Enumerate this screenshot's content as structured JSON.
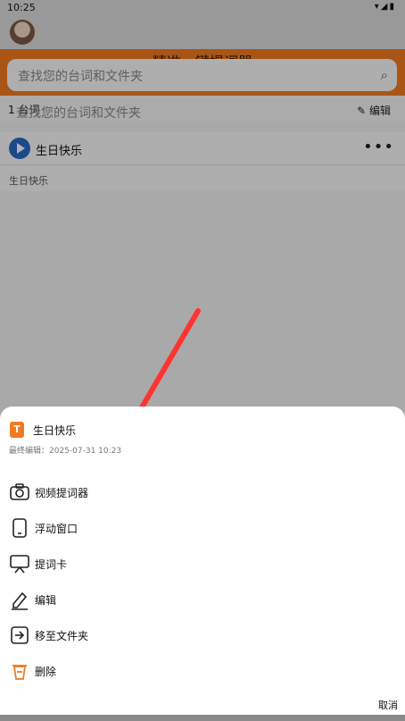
{
  "status": {
    "time": "10:25",
    "icons": "wifi-icon signal-icon battery-icon"
  },
  "header": {
    "title": "精准一键提词器"
  },
  "search": {
    "placeholder": "查找您的台词和文件夹"
  },
  "list_header": {
    "count": "1 台词",
    "placeholder": "查找您的台词和文件夹",
    "edit": "编辑"
  },
  "item": {
    "name": "生日快乐",
    "more": "•••",
    "preview": "生日快乐"
  },
  "sheet": {
    "file_icon_letter": "T",
    "file_name": "生日快乐",
    "edited": "最终编辑：2025-07-31 10:23",
    "actions": [
      {
        "label": "视频提词器",
        "icon": "camera-icon"
      },
      {
        "label": "浮动窗口",
        "icon": "phone-icon"
      },
      {
        "label": "提词卡",
        "icon": "presentation-board-icon"
      },
      {
        "label": "编辑",
        "icon": "pencil-icon"
      },
      {
        "label": "移至文件夹",
        "icon": "move-to-folder-icon"
      },
      {
        "label": "删除",
        "icon": "trash-icon"
      }
    ],
    "cancel": "取消"
  },
  "colors": {
    "accent": "#f27a20",
    "play": "#2a67c9",
    "arrow": "#ff3333"
  }
}
